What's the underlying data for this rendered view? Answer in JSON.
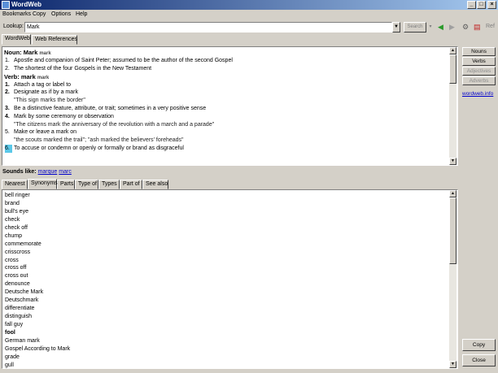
{
  "window": {
    "title": "WordWeb"
  },
  "menu": [
    "Bookmarks",
    "Copy",
    "Options",
    "Help"
  ],
  "toolbar": {
    "lookup_label": "Lookup:",
    "lookup_value": "Mark",
    "search_label": "Search",
    "ref_label": "Ref"
  },
  "top_tabs": [
    "WordWeb",
    "Web References"
  ],
  "definitions": {
    "noun_head": "Noun: Mark",
    "noun_small": "mark",
    "noun_senses": [
      {
        "num": "1.",
        "text": "Apostle and companion of Saint Peter; assumed to be the author of the second Gospel"
      },
      {
        "num": "2.",
        "text": "The shortest of the four Gospels in the New Testament"
      }
    ],
    "verb_head": "Verb: mark",
    "verb_small": "mark",
    "verb_senses": [
      {
        "num": "1.",
        "text": "Attach a tag or label to",
        "example": ""
      },
      {
        "num": "2.",
        "text": "Designate as if by a mark",
        "example": "\"This sign marks the border\""
      },
      {
        "num": "3.",
        "text": "Be a distinctive feature, attribute, or trait; sometimes in a very positive sense",
        "example": ""
      },
      {
        "num": "4.",
        "text": "Mark by some ceremony or observation",
        "example": "\"The citizens mark the anniversary of the revolution with a march and a parade\""
      },
      {
        "num": "5.",
        "text": "Make or leave a mark on",
        "example": "\"the scouts marked the trail\"; \"ash marked the believers' foreheads\""
      },
      {
        "num": "6.",
        "text": "To accuse or condemn or openly or formally or brand as disgraceful",
        "example": ""
      }
    ]
  },
  "sounds_like": {
    "label": "Sounds like:",
    "words": [
      "marque",
      "marc"
    ]
  },
  "bottom_tabs": [
    "Nearest",
    "Synonyms",
    "Parts",
    "Type of",
    "Types",
    "Part of",
    "See also"
  ],
  "synonyms": [
    "bell ringer",
    "brand",
    "bull's eye",
    "check",
    "check off",
    "chump",
    "commemorate",
    "crisscross",
    "cross",
    "cross off",
    "cross out",
    "denounce",
    "Deutsche Mark",
    "Deutschmark",
    "differentiate",
    "distinguish",
    "fall guy",
    "fool",
    "German mark",
    "Gospel According to Mark",
    "grade",
    "gull"
  ],
  "right_panel": {
    "buttons": [
      "Nouns",
      "Verbs",
      "Adjectives",
      "Adverbs"
    ],
    "web_link": "wordweb.info",
    "copy_label": "Copy",
    "close_label": "Close"
  },
  "colors": {
    "title_bar": "#0a246a",
    "highlight": "#5bc8e8",
    "link": "#0000cc"
  }
}
